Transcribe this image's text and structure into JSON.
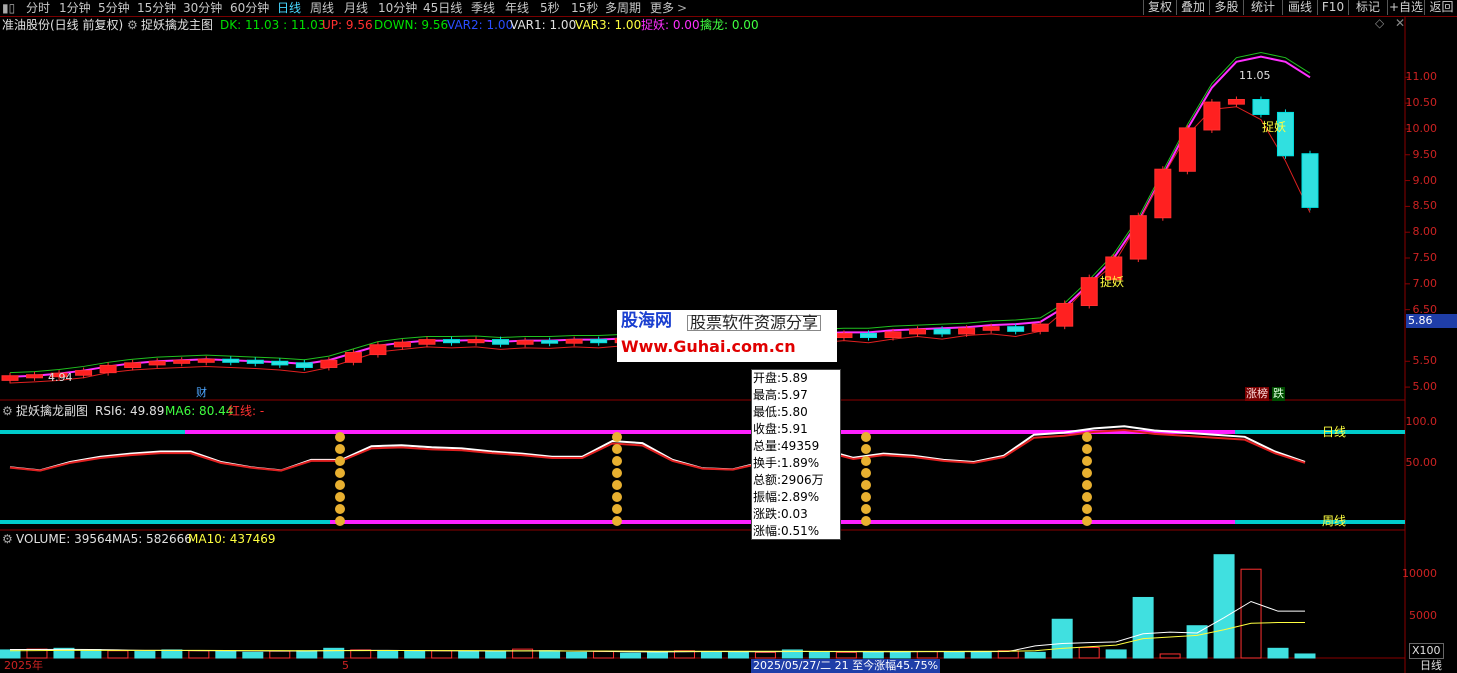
{
  "toolbar": {
    "periods": [
      "分时",
      "1分钟",
      "5分钟",
      "15分钟",
      "30分钟",
      "60分钟",
      "日线",
      "周线",
      "月线",
      "10分钟",
      "45日线",
      "季线",
      "年线",
      "5秒",
      "15秒",
      "多周期",
      "更多"
    ],
    "active": "日线",
    "right_buttons": [
      "复权",
      "叠加",
      "多股",
      "统计",
      "画线",
      "F10",
      "标记",
      "+自选",
      "返回"
    ]
  },
  "main_panel": {
    "stock": "准油股份(日线 前复权)",
    "indicator": "捉妖擒龙主图",
    "values": [
      {
        "text": "DK: 11.03 : 11.03",
        "color": "#00e000"
      },
      {
        "text": "UP: 9.56",
        "color": "#ff3030"
      },
      {
        "text": "DOWN: 9.56",
        "color": "#00e000"
      },
      {
        "text": "VAR2: 1.00",
        "color": "#2a4dff"
      },
      {
        "text": "VAR1: 1.00",
        "color": "#e0e0e0"
      },
      {
        "text": "VAR3: 1.00",
        "color": "#ffff40"
      },
      {
        "text": "捉妖: 0.00",
        "color": "#ff30ff"
      },
      {
        "text": "擒龙: 0.00",
        "color": "#40ff40"
      }
    ],
    "y_ticks": [
      "11.00",
      "10.50",
      "10.00",
      "9.50",
      "9.00",
      "8.50",
      "8.00",
      "7.50",
      "7.00",
      "6.50",
      "5.50",
      "5.00"
    ],
    "last_price": "5.86",
    "high_label": "11.05",
    "low_label": "4.94",
    "signal_label": "捉妖",
    "cai_label": "财",
    "zhangbang": "涨榜",
    "die": "跌"
  },
  "sub_panel": {
    "title": "捉妖擒龙副图",
    "values": [
      {
        "text": "RSI6: 49.89",
        "color": "#e0e0e0"
      },
      {
        "text": "MA6: 80.44",
        "color": "#40ff40"
      },
      {
        "text": "红线: -",
        "color": "#ff3030"
      }
    ],
    "y_ticks": [
      "100.0",
      "50.00"
    ],
    "day_label": "日线",
    "week_label": "周线"
  },
  "volume_panel": {
    "title": "VOLUME: 39564",
    "values": [
      {
        "text": "MA5: 582666",
        "color": "#e0e0e0"
      },
      {
        "text": "MA10: 437469",
        "color": "#ffff40"
      }
    ],
    "y_ticks": [
      "10000",
      "5000"
    ],
    "unit": "X100"
  },
  "bottom": {
    "year": "2025年",
    "month": "5",
    "status": "2025/05/27/二 21 至今涨幅45.75%",
    "period": "日线"
  },
  "watermark": {
    "line1": "股海网",
    "line1b": "股票软件资源分享",
    "line2": "Www.Guhai.com.cn"
  },
  "tooltip": {
    "lines": [
      "开盘:5.89",
      "最高:5.97",
      "最低:5.80",
      "收盘:5.91",
      "总量:49359",
      "换手:1.89%",
      "总额:2906万",
      "振幅:2.89%",
      "涨跌:0.03",
      "涨幅:0.51%"
    ]
  },
  "chart_data": [
    {
      "type": "candlestick",
      "title": "捉妖擒龙主图",
      "ylim": [
        4.75,
        11.8
      ],
      "series": [
        {
          "name": "close",
          "values": [
            5.2,
            5.22,
            5.25,
            5.3,
            5.4,
            5.45,
            5.48,
            5.5,
            5.52,
            5.5,
            5.48,
            5.45,
            5.4,
            5.5,
            5.65,
            5.8,
            5.85,
            5.9,
            5.88,
            5.9,
            5.85,
            5.88,
            5.87,
            5.9,
            5.88,
            5.92,
            5.95,
            5.95,
            5.9,
            5.92,
            5.9,
            5.95,
            6.0,
            5.98,
            6.02,
            5.98,
            6.05,
            6.1,
            6.05,
            6.12,
            6.15,
            6.1,
            6.2,
            6.6,
            7.1,
            7.5,
            8.3,
            9.2,
            10.0,
            10.5,
            10.55,
            10.3,
            9.5,
            8.5
          ]
        },
        {
          "name": "DK",
          "values": [
            5.2,
            5.22,
            5.26,
            5.32,
            5.4,
            5.46,
            5.5,
            5.52,
            5.54,
            5.52,
            5.5,
            5.48,
            5.45,
            5.52,
            5.66,
            5.8,
            5.86,
            5.9,
            5.9,
            5.91,
            5.88,
            5.9,
            5.9,
            5.92,
            5.92,
            5.94,
            5.96,
            5.98,
            5.97,
            5.96,
            5.96,
            5.98,
            6.02,
            6.04,
            6.06,
            6.06,
            6.1,
            6.12,
            6.14,
            6.16,
            6.2,
            6.22,
            6.26,
            6.55,
            7.0,
            7.5,
            8.2,
            9.1,
            10.0,
            10.8,
            11.3,
            11.4,
            11.3,
            11.0
          ]
        }
      ]
    },
    {
      "type": "line",
      "title": "捉妖擒龙副图",
      "ylim": [
        0,
        100
      ],
      "series": [
        {
          "name": "RSI6",
          "values": [
            55,
            52,
            60,
            65,
            68,
            70,
            70,
            60,
            55,
            52,
            62,
            62,
            75,
            76,
            74,
            73,
            70,
            68,
            65,
            65,
            80,
            78,
            62,
            54,
            53,
            60,
            70,
            72,
            64,
            68,
            66,
            62,
            60,
            66,
            86,
            88,
            92,
            94,
            90,
            88,
            86,
            84,
            70,
            60
          ]
        }
      ]
    },
    {
      "type": "bar",
      "title": "VOLUME",
      "ylim": [
        0,
        14000
      ],
      "series": [
        {
          "name": "VOLUME",
          "values": [
            1000,
            1100,
            1200,
            1050,
            900,
            800,
            1000,
            900,
            800,
            700,
            850,
            900,
            1200,
            1000,
            850,
            900,
            900,
            800,
            800,
            1100,
            900,
            700,
            800,
            600,
            700,
            900,
            700,
            800,
            700,
            1000,
            800,
            700,
            800,
            800,
            800,
            700,
            800,
            900,
            700,
            4800,
            1300,
            1000,
            7500,
            500,
            4000,
            12800,
            11000,
            1200,
            500
          ]
        },
        {
          "name": "MA5",
          "values": [
            1050,
            1060,
            1070,
            1050,
            1000,
            950,
            950,
            920,
            900,
            880,
            860,
            870,
            920,
            950,
            950,
            920,
            900,
            880,
            860,
            880,
            900,
            850,
            820,
            780,
            760,
            780,
            800,
            790,
            770,
            800,
            800,
            790,
            780,
            780,
            790,
            790,
            790,
            800,
            1500,
            1800,
            1900,
            2000,
            3000,
            3200,
            3100,
            5000,
            7000,
            5800,
            5800
          ]
        },
        {
          "name": "MA10",
          "values": [
            900,
            920,
            940,
            950,
            950,
            950,
            950,
            940,
            930,
            920,
            910,
            900,
            910,
            920,
            930,
            930,
            920,
            910,
            900,
            890,
            880,
            870,
            860,
            850,
            840,
            840,
            840,
            830,
            830,
            830,
            820,
            820,
            820,
            820,
            820,
            820,
            830,
            840,
            900,
            1200,
            1400,
            1600,
            2400,
            2600,
            2800,
            3500,
            4300,
            4400,
            4400
          ]
        }
      ]
    }
  ]
}
